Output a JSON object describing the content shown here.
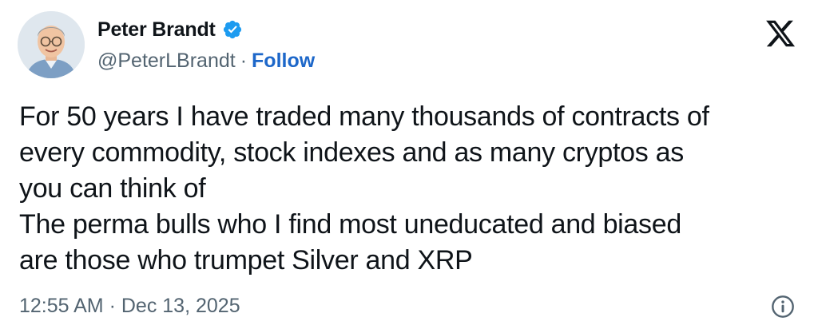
{
  "author": {
    "display_name": "Peter Brandt",
    "handle": "@PeterLBrandt",
    "separator": "·",
    "follow_label": "Follow",
    "verified_icon": "verified-badge-icon",
    "avatar_icon": "avatar-portrait"
  },
  "platform": {
    "logo_icon": "x-logo-icon"
  },
  "tweet": {
    "lines": [
      "For 50 years I have traded many thousands of contracts of",
      "every commodity, stock indexes and as many cryptos as",
      "you can think of",
      "The perma bulls who I find most uneducated and biased",
      "are those who trumpet Silver and XRP"
    ]
  },
  "meta": {
    "time": "12:55 AM",
    "separator": "·",
    "date": "Dec 13, 2025",
    "info_icon": "info-icon"
  },
  "colors": {
    "text": "#0f1419",
    "secondary": "#536471",
    "follow": "#1d67c9",
    "verified": "#1d9bf0"
  }
}
